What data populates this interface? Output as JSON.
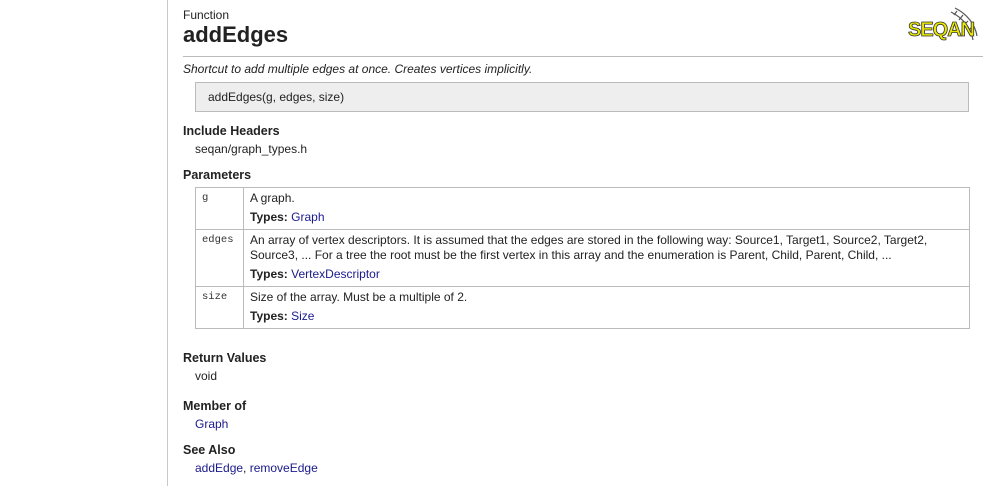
{
  "header": {
    "kind": "Function",
    "title": "addEdges",
    "logo_text": "SEQAN"
  },
  "summary": "Shortcut to add multiple edges at once. Creates vertices implicitly.",
  "signature": "addEdges(g, edges, size)",
  "include_headers": {
    "heading": "Include Headers",
    "value": "seqan/graph_types.h"
  },
  "parameters": {
    "heading": "Parameters",
    "types_label": "Types:",
    "rows": [
      {
        "name": "g",
        "description": "A graph.",
        "type": "Graph"
      },
      {
        "name": "edges",
        "description": "An array of vertex descriptors. It is assumed that the edges are stored in the following way: Source1, Target1, Source2, Target2, Source3, ... For a tree the root must be the first vertex in this array and the enumeration is Parent, Child, Parent, Child, ...",
        "type": "VertexDescriptor"
      },
      {
        "name": "size",
        "description": "Size of the array. Must be a multiple of 2.",
        "type": "Size"
      }
    ]
  },
  "return_values": {
    "heading": "Return Values",
    "value": "void"
  },
  "member_of": {
    "heading": "Member of",
    "link": "Graph"
  },
  "see_also": {
    "heading": "See Also",
    "links": [
      "addEdge",
      "removeEdge"
    ],
    "separator": ", "
  },
  "colors": {
    "link": "#1a1a8c",
    "logo_yellow": "#e8e800",
    "logo_dark": "#222222"
  }
}
